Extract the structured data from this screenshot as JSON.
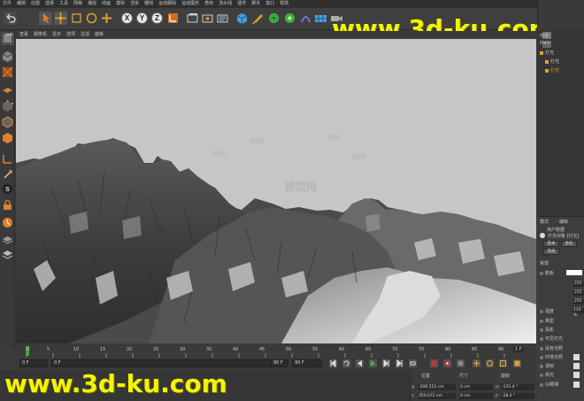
{
  "menubar": {
    "items": [
      "文件",
      "编辑",
      "创建",
      "选择",
      "工具",
      "网格",
      "捕捉",
      "动画",
      "模拟",
      "渲染",
      "雕刻",
      "运动跟踪",
      "运动图形",
      "角色",
      "流水线",
      "插件",
      "脚本",
      "窗口",
      "帮助"
    ]
  },
  "toolbar": {
    "axis_labels": [
      "X",
      "Y",
      "Z"
    ]
  },
  "viewport": {
    "menu": [
      "查看",
      "摄像机",
      "显示",
      "选项",
      "过滤",
      "面板"
    ],
    "watermarks": [
      "模型网",
      "模型网",
      "模型网",
      "模型网"
    ],
    "center_logo": "模型网"
  },
  "objects": {
    "items": [
      "环境",
      "Plain",
      "灯光",
      "灯光",
      "灯光"
    ]
  },
  "attributes": {
    "tabs": [
      "模式",
      "编辑",
      "用户数据"
    ],
    "title": "灯光对象 [灯光]",
    "buttons": [
      "基本",
      "坐标",
      "常规"
    ],
    "section": "常规",
    "rows": [
      "颜色",
      "强度",
      "类型",
      "投影",
      "可见灯光",
      "没有光照",
      "环境光照",
      "漫射",
      "高光",
      "GI照明"
    ],
    "values": [
      "255",
      "255",
      "255",
      "110 %"
    ]
  },
  "timeline": {
    "ticks": [
      "0",
      "5",
      "10",
      "15",
      "20",
      "25",
      "30",
      "35",
      "40",
      "45",
      "50",
      "55",
      "60",
      "65",
      "70",
      "75",
      "80",
      "85",
      "90"
    ],
    "end_frame": "1 F"
  },
  "transport": {
    "current_frame": "0 F",
    "start_field": "0 F",
    "end_field": "90 F",
    "end_field2": "90 F"
  },
  "coordinates": {
    "headers": [
      "位置",
      "尺寸",
      "旋转"
    ],
    "axis_x": "X",
    "axis_y": "Y",
    "pos_x": "-290.553 cm",
    "pos_y": "350.072 cm",
    "size_x": "0 cm",
    "size_y": "0 cm",
    "rot_h_label": "H",
    "rot_p_label": "P",
    "rot_h": "-155.4 °",
    "rot_p": "-28.4 °"
  },
  "site": {
    "top": "www.3d-ku.com",
    "bottom": "www.3d-ku.com"
  },
  "colors": {
    "site_text": "#f4f400",
    "viewport_bg": "#c6c6c6",
    "ui_bg": "#3c3c3c"
  }
}
